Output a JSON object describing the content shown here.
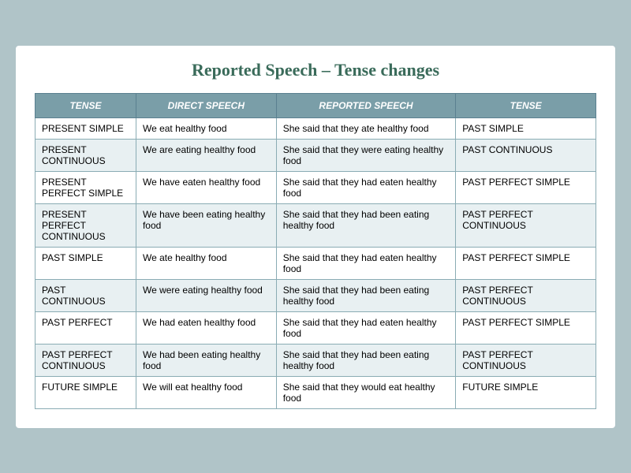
{
  "title": "Reported Speech – Tense changes",
  "table": {
    "headers": [
      "TENSE",
      "DIRECT SPEECH",
      "REPORTED SPEECH",
      "TENSE"
    ],
    "rows": [
      {
        "tense": "PRESENT SIMPLE",
        "direct": "We eat healthy food",
        "reported": "She said that they ate healthy food",
        "result_tense": "PAST SIMPLE"
      },
      {
        "tense": "PRESENT CONTINUOUS",
        "direct": "We are eating healthy food",
        "reported": "She said that they were eating healthy food",
        "result_tense": "PAST CONTINUOUS"
      },
      {
        "tense": "PRESENT PERFECT SIMPLE",
        "direct": "We have eaten healthy food",
        "reported": "She said that they had eaten healthy food",
        "result_tense": "PAST PERFECT SIMPLE"
      },
      {
        "tense": "PRESENT PERFECT CONTINUOUS",
        "direct": "We have been eating healthy food",
        "reported": "She said that they had been eating healthy food",
        "result_tense": "PAST PERFECT CONTINUOUS"
      },
      {
        "tense": "PAST SIMPLE",
        "direct": "We ate healthy food",
        "reported": "She said that they had eaten healthy food",
        "result_tense": "PAST PERFECT SIMPLE"
      },
      {
        "tense": "PAST CONTINUOUS",
        "direct": "We were eating healthy food",
        "reported": "She said that they had been eating healthy food",
        "result_tense": "PAST PERFECT CONTINUOUS"
      },
      {
        "tense": "PAST PERFECT",
        "direct": "We had eaten healthy food",
        "reported": "She said that they had eaten healthy food",
        "result_tense": "PAST PERFECT SIMPLE"
      },
      {
        "tense": "PAST PERFECT CONTINUOUS",
        "direct": "We had been eating healthy food",
        "reported": "She said that they had been eating  healthy food",
        "result_tense": "PAST PERFECT CONTINUOUS"
      },
      {
        "tense": "FUTURE SIMPLE",
        "direct": "We will eat healthy food",
        "reported": "She said that they would eat healthy food",
        "result_tense": "FUTURE SIMPLE"
      }
    ]
  }
}
